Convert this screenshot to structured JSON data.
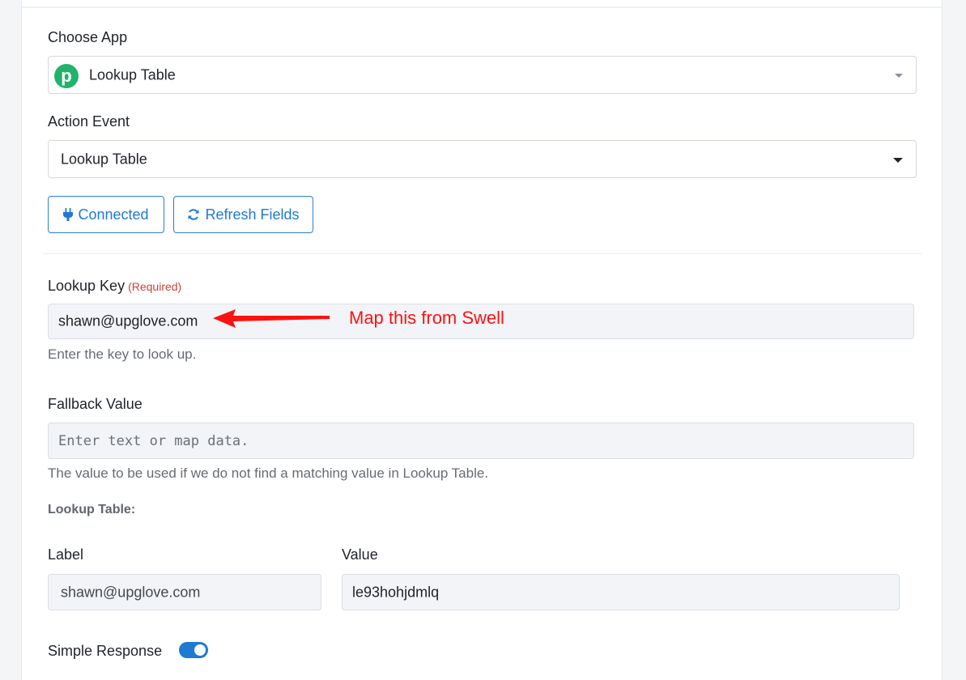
{
  "choose_app": {
    "label": "Choose App",
    "selected": "Lookup Table",
    "logo_letter": "p"
  },
  "action_event": {
    "label": "Action Event",
    "selected": "Lookup Table"
  },
  "buttons": {
    "connected": "Connected",
    "refresh": "Refresh Fields"
  },
  "lookup_key": {
    "label": "Lookup Key",
    "required": "(Required)",
    "value": "shawn@upglove.com",
    "help": "Enter the key to look up."
  },
  "annotation": {
    "text": "Map this from Swell",
    "color": "#ff1111"
  },
  "fallback": {
    "label": "Fallback Value",
    "placeholder": "Enter text or map data.",
    "help": "The value to be used if we do not find a matching value in Lookup Table."
  },
  "lookup_table": {
    "title": "Lookup Table:",
    "label_header": "Label",
    "value_header": "Value",
    "rows": [
      {
        "label": "shawn@upglove.com",
        "value": "le93hohjdmlq"
      }
    ]
  },
  "simple_response": {
    "label": "Simple Response",
    "enabled": true
  },
  "colors": {
    "accent": "#1f7ad1",
    "brand_green": "#21b36b",
    "required": "#c8423b"
  }
}
